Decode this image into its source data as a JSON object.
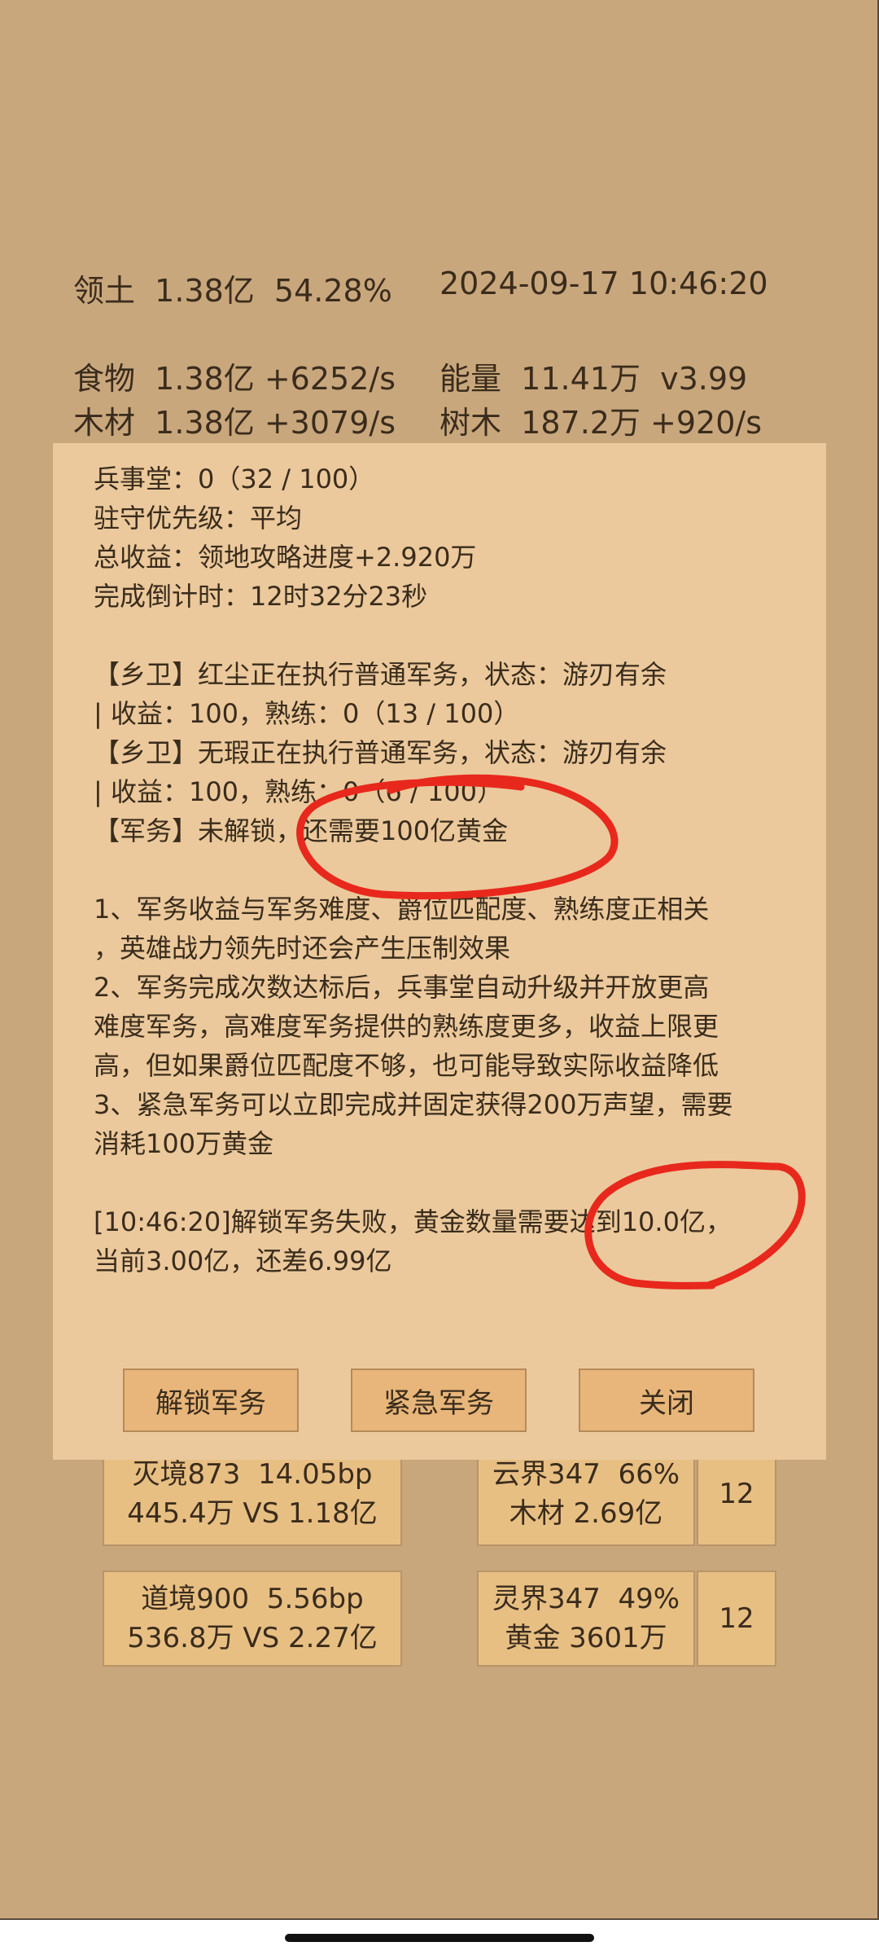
{
  "header": {
    "territory": "领土  1.38亿  54.28%",
    "datetime": "2024-09-17 10:46:20",
    "food": "食物  1.38亿 +6252/s",
    "energy": "能量  11.41万  v3.99",
    "wood": "木材  1.38亿 +3079/s",
    "trees": "树木  187.2万 +920/s"
  },
  "dialog": {
    "lines": [
      "兵事堂：0（32 / 100）",
      "驻守优先级：平均",
      "总收益：领地攻略进度+2.920万",
      "完成倒计时：12时32分23秒",
      "",
      "【乡卫】红尘正在执行普通军务，状态：游刃有余",
      "| 收益：100，熟练：0（13 / 100）",
      "【乡卫】无瑕正在执行普通军务，状态：游刃有余",
      "| 收益：100，熟练：0（6 / 100）",
      "【军务】未解锁，还需要100亿黄金",
      "",
      "1、军务收益与军务难度、爵位匹配度、熟练度正相关",
      "，英雄战力领先时还会产生压制效果",
      "2、军务完成次数达标后，兵事堂自动升级并开放更高",
      "难度军务，高难度军务提供的熟练度更多，收益上限更",
      "高，但如果爵位匹配度不够，也可能导致实际收益降低",
      "3、紧急军务可以立即完成并固定获得200万声望，需要",
      "消耗100万黄金",
      "",
      "[10:46:20]解锁军务失败，黄金数量需要达到10.0亿，",
      "当前3.00亿，还差6.99亿"
    ],
    "buttons": {
      "unlock": "解锁军务",
      "emergency": "紧急军务",
      "close": "关闭"
    }
  },
  "cards": {
    "realm1": {
      "line1": "灭境873  14.05bp",
      "line2": "445.4万 VS 1.18亿"
    },
    "world1": {
      "line1": "云界347  66%",
      "line2": "木材 2.69亿",
      "count": "12"
    },
    "realm2": {
      "line1": "道境900  5.56bp",
      "line2": "536.8万 VS 2.27亿"
    },
    "world2": {
      "line1": "灵界347  49%",
      "line2": "黄金 3601万",
      "count": "12"
    }
  },
  "colors": {
    "background": "#c9a77d",
    "dialog": "#ebc99c",
    "button": "#e8b67a",
    "annotation": "#e8281c"
  }
}
